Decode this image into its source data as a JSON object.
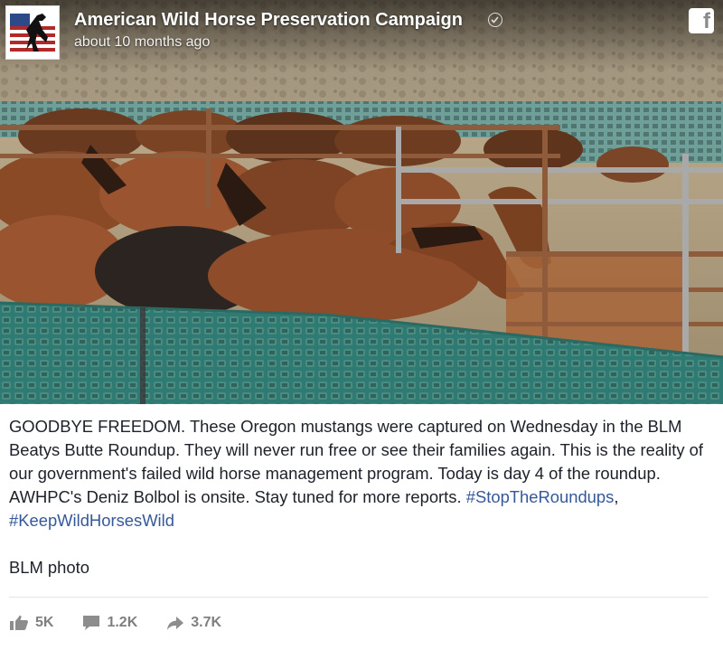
{
  "post": {
    "page_name": "American Wild Horse Preservation Campaign",
    "timestamp": "about 10 months ago",
    "brand_icon": "facebook-f-icon",
    "avatar_icon": "rearing-horse-flag-logo",
    "verified_icon": "verified-check-icon"
  },
  "caption": {
    "text": "GOODBYE FREEDOM. These Oregon mustangs were captured on Wednesday in the BLM Beatys Butte Roundup. They will never run free or see their families again. This is the reality of our government's failed wild horse management program. Today is day 4 of the roundup. AWHPC's Deniz Bolbol is onsite. Stay tuned for more reports.",
    "hashtag_1": "#StopTheRoundups",
    "separator": ",",
    "hashtag_2": "#KeepWildHorsesWild",
    "credit": "BLM photo"
  },
  "stats": {
    "likes": "5K",
    "comments": "1.2K",
    "shares": "3.7K"
  },
  "colors": {
    "hashtag": "#365899",
    "body_text": "#1d2129",
    "stat_text": "#7f7f7f",
    "fence_mesh": "#3a8a82"
  }
}
